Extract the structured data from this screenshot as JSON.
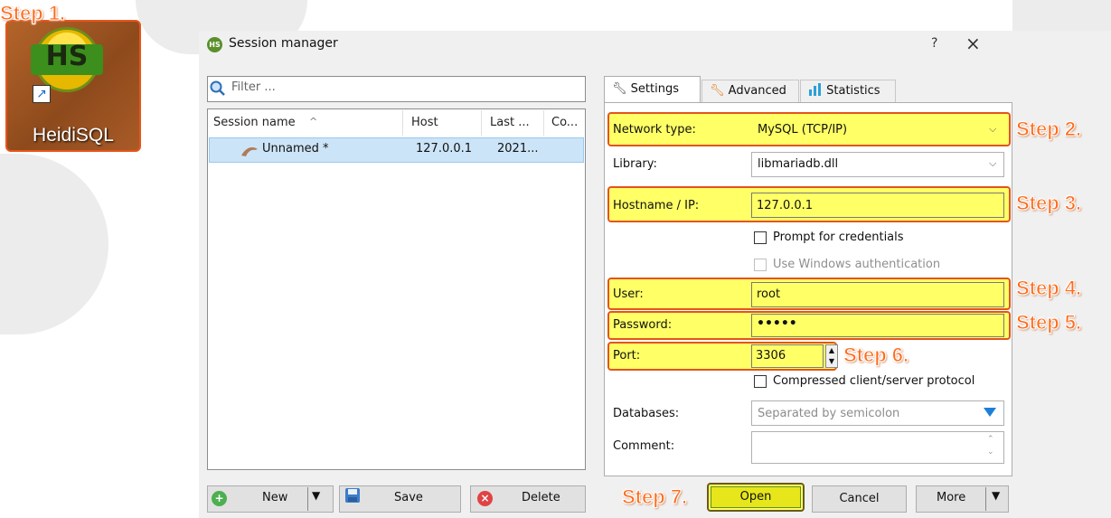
{
  "desktop": {
    "icon_letters": "HS",
    "label": "HeidiSQL"
  },
  "steps": {
    "s1": "Step 1.",
    "s2": "Step 2.",
    "s3": "Step 3.",
    "s4": "Step 4.",
    "s5": "Step 5.",
    "s6": "Step 6.",
    "s7": "Step 7."
  },
  "dialog": {
    "title": "Session manager",
    "title_icon": "HS",
    "help": "?",
    "close": "×"
  },
  "left": {
    "filter_placeholder": "Filter ...",
    "columns": [
      "Session name",
      "Host",
      "Last ...",
      "Co..."
    ],
    "sort_glyph": "^",
    "session": {
      "name": "Unnamed *",
      "host": "127.0.0.1",
      "last": "2021..."
    },
    "buttons": {
      "new": "New",
      "save": "Save",
      "delete": "Delete"
    }
  },
  "tabs": {
    "settings": "Settings",
    "advanced": "Advanced",
    "statistics": "Statistics"
  },
  "settings": {
    "network_type_label": "Network type:",
    "network_type_value": "MySQL (TCP/IP)",
    "library_label": "Library:",
    "library_value": "libmariadb.dll",
    "hostname_label": "Hostname / IP:",
    "hostname_value": "127.0.0.1",
    "prompt_credentials": "Prompt for credentials",
    "use_windows_auth": "Use Windows authentication",
    "user_label": "User:",
    "user_value": "root",
    "password_label": "Password:",
    "password_value": "•••••",
    "port_label": "Port:",
    "port_value": "3306",
    "compressed": "Compressed client/server protocol",
    "databases_label": "Databases:",
    "databases_placeholder": "Separated by semicolon",
    "comment_label": "Comment:"
  },
  "bottom": {
    "open": "Open",
    "cancel": "Cancel",
    "more": "More"
  },
  "colors": {
    "highlight": "#ffff66",
    "step_orange": "#ff6a1a",
    "selection": "#cce4f7"
  }
}
